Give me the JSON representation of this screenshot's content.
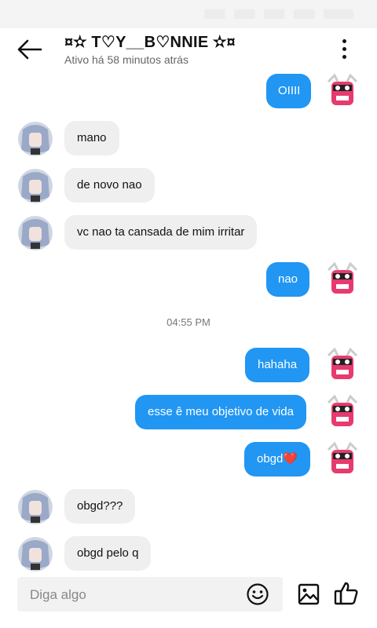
{
  "header": {
    "contact_name": "¤✫ T♡Y__B♡NNIE ✫¤",
    "status": "Ativo há 58 minutos atrás"
  },
  "messages": [
    {
      "dir": "out",
      "text": "OIIII"
    },
    {
      "dir": "in",
      "text": "mano"
    },
    {
      "dir": "in",
      "text": "de novo nao"
    },
    {
      "dir": "in",
      "text": "vc nao ta cansada de mim irritar"
    },
    {
      "dir": "out",
      "text": "nao"
    },
    {
      "dir": "time",
      "text": "04:55 PM"
    },
    {
      "dir": "out",
      "text": "hahaha"
    },
    {
      "dir": "out",
      "text": "esse ê meu objetivo de vida"
    },
    {
      "dir": "out",
      "text": "obgd❤️"
    },
    {
      "dir": "in",
      "text": "obgd???"
    },
    {
      "dir": "in",
      "text": "obgd pelo q"
    }
  ],
  "composer": {
    "placeholder": "Diga algo"
  },
  "colors": {
    "outgoing_bubble": "#2196f3",
    "incoming_bubble": "#efefef",
    "accent_avatar": "#e83a6e"
  },
  "icons": [
    "back-arrow-icon",
    "more-vert-icon",
    "emoji-icon",
    "image-icon",
    "thumbs-up-icon"
  ]
}
